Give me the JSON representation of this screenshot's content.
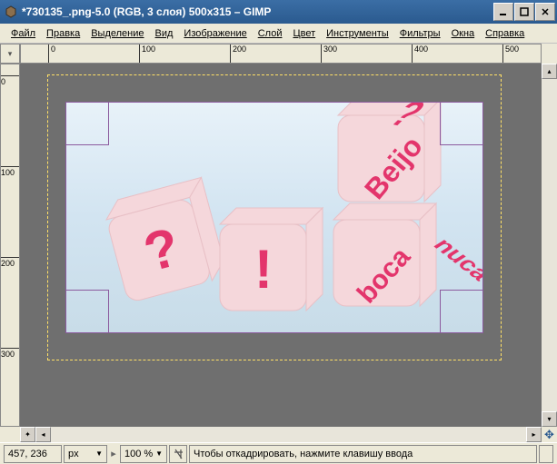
{
  "title": "*730135_.png-5.0 (RGB, 3 слоя) 500x315 – GIMP",
  "menu": {
    "file": "Файл",
    "edit": "Правка",
    "select": "Выделение",
    "view": "Вид",
    "image": "Изображение",
    "layer": "Слой",
    "color": "Цвет",
    "tools": "Инструменты",
    "filters": "Фильтры",
    "windows": "Окна",
    "help": "Справка"
  },
  "ruler_h": [
    "0",
    "100",
    "200",
    "300",
    "400",
    "500"
  ],
  "ruler_v": [
    "0",
    "100",
    "200",
    "300"
  ],
  "dice": {
    "q": "?",
    "excl": "!",
    "beijo": "Beijo",
    "q2": "?",
    "boca": "boca",
    "nuca": "nuca"
  },
  "status": {
    "coords": "457, 236",
    "unit": "px",
    "zoom": "100 %",
    "message": "Чтобы откадрировать, нажмите клавишу ввода"
  }
}
